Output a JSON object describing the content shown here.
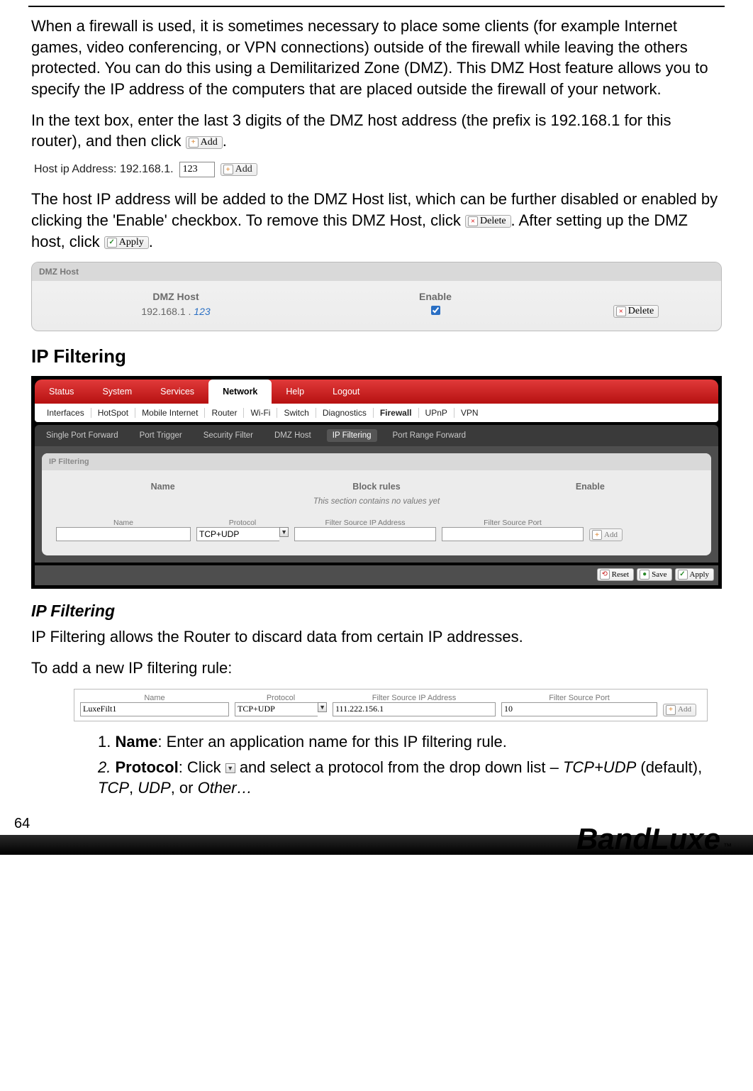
{
  "intro_para": "When a firewall is used, it is sometimes necessary to place some clients (for example Internet games, video conferencing, or VPN connections) outside of the firewall while leaving the others protected. You can do this using a Demilitarized Zone (DMZ). This DMZ Host feature allows you to specify the IP address of the computers that are placed outside the firewall of your network.",
  "para2_a": "In the text box, enter the last 3 digits of the DMZ host address (the prefix is 192.168.1 for this router), and then click ",
  "para2_b": ".",
  "btn_add": "Add",
  "dmz_input": {
    "label": "Host ip Address: 192.168.1.",
    "value": "123"
  },
  "para3_a": "The host IP address will be added to the DMZ Host list, which can be further disabled or enabled by clicking the 'Enable' checkbox. To remove this DMZ Host, click ",
  "para3_b": ". After setting up the DMZ host, click ",
  "para3_c": ".",
  "btn_delete": "Delete",
  "btn_apply": "Apply",
  "btn_save": "Save",
  "btn_reset": "Reset",
  "dmz_panel": {
    "title": "DMZ Host",
    "col_host": "DMZ Host",
    "col_enable": "Enable",
    "ip_prefix": "192.168.1 . ",
    "ip_suffix": "123"
  },
  "h2_ipfilter": "IP Filtering",
  "router": {
    "top_tabs": [
      "Status",
      "System",
      "Services",
      "Network",
      "Help",
      "Logout"
    ],
    "top_active": "Network",
    "sub_tabs": [
      "Interfaces",
      "HotSpot",
      "Mobile Internet",
      "Router",
      "Wi-Fi",
      "Switch",
      "Diagnostics",
      "Firewall",
      "UPnP",
      "VPN"
    ],
    "sub_active": "Firewall",
    "tert_tabs": [
      "Single Port Forward",
      "Port Trigger",
      "Security Filter",
      "DMZ Host",
      "IP Filtering",
      "Port Range Forward"
    ],
    "tert_active": "IP Filtering",
    "panel_title": "IP Filtering",
    "cols": {
      "name": "Name",
      "block": "Block rules",
      "enable": "Enable"
    },
    "empty_msg": "This section contains no values yet",
    "addrow": {
      "h_name": "Name",
      "h_proto": "Protocol",
      "h_src": "Filter Source IP Address",
      "h_port": "Filter Source Port",
      "proto_value": "TCP+UDP"
    }
  },
  "h3_ipfilter": "IP Filtering",
  "ipf_desc": "IP Filtering allows the Router to discard data from certain IP addresses.",
  "ipf_add_intro": "To add a new IP filtering rule:",
  "addrow2": {
    "h_name": "Name",
    "h_proto": "Protocol",
    "h_src": "Filter Source IP Address",
    "h_port": "Filter Source Port",
    "v_name": "LuxeFilt1",
    "v_proto": "TCP+UDP",
    "v_src": "111.222.156.1",
    "v_port": "10"
  },
  "steps": {
    "s1_label": "Name",
    "s1_text": ": Enter an application name for this IP filtering rule.",
    "s2_label": "Protocol",
    "s2_a": ": Click ",
    "s2_b": " and select a protocol from the drop down list – ",
    "s2_tcpudp": "TCP+UDP",
    "s2_def": " (default), ",
    "s2_tcp": "TCP",
    "s2_c": ", ",
    "s2_udp": "UDP",
    "s2_d": ", or ",
    "s2_other": "Other…"
  },
  "page_number": "64",
  "brand": "BandLuxe",
  "tm": "™"
}
